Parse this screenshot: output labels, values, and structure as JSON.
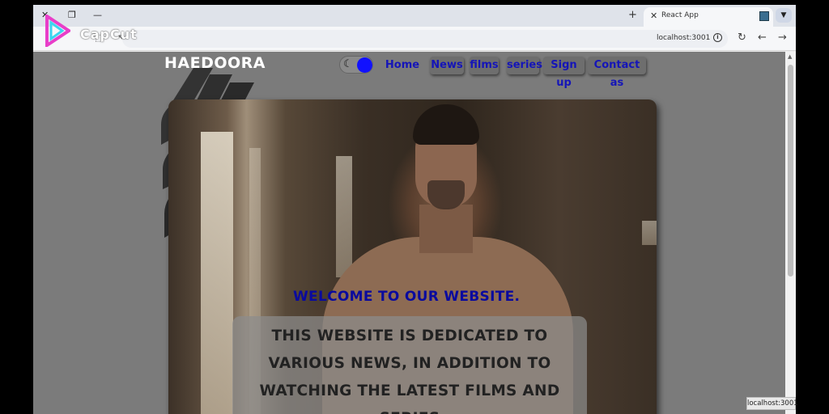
{
  "browser": {
    "tab_title": "React App",
    "url": "localhost:3001",
    "new_tab_symbol": "+",
    "status_url": "localhost:3001"
  },
  "watermark": {
    "text": "CapCut"
  },
  "site": {
    "brand": "HAEDOORA",
    "nav": [
      {
        "label": "Home"
      },
      {
        "label": "News"
      },
      {
        "label": "films"
      },
      {
        "label": "series"
      },
      {
        "label": "Sign up"
      },
      {
        "label": "Contact as"
      }
    ],
    "theme_toggle": {
      "moon_glyph": "☾",
      "knob_color": "#1111ff"
    },
    "hero": {
      "heading": "WELCOME TO OUR WEBSITE.",
      "body": "THIS WEBSITE IS DEDICATED TO VARIOUS NEWS, IN ADDITION TO WATCHING THE LATEST FILMS AND SERIES"
    }
  },
  "colors": {
    "page_bg": "#7b7b7b",
    "nav_text": "#1515b8",
    "heading": "#0a0a9e"
  }
}
